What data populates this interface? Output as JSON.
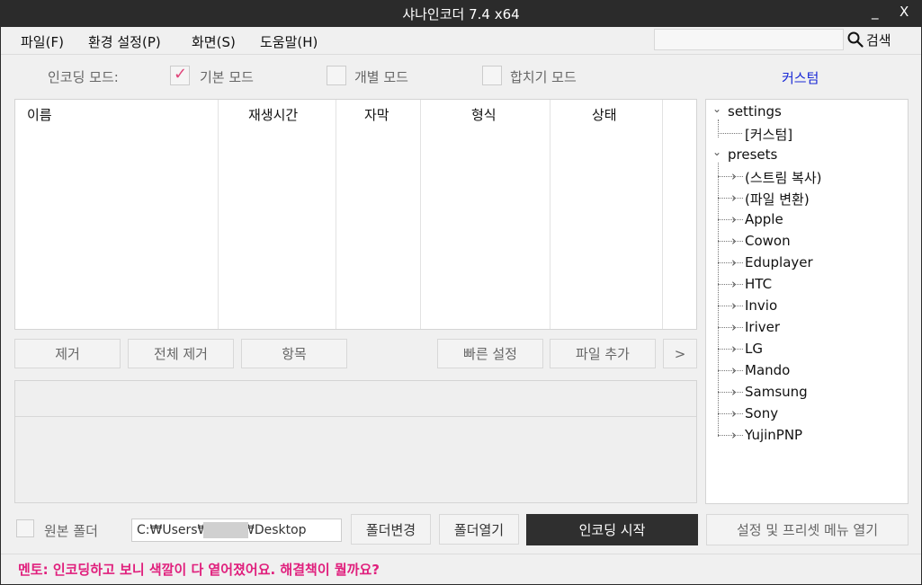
{
  "window": {
    "title": "샤나인코더  7.4 x64",
    "minimize": "_",
    "close": "X"
  },
  "menu": {
    "file": "파일(F)",
    "settings": "환경 설정(P)",
    "view": "화면(S)",
    "help": "도움말(H)"
  },
  "search": {
    "value": "",
    "button_label": "검색",
    "icon": "search-icon"
  },
  "encoding_mode": {
    "label": "인코딩 모드:",
    "options": [
      {
        "label": "기본 모드",
        "checked": true
      },
      {
        "label": "개별 모드",
        "checked": false
      },
      {
        "label": "합치기 모드",
        "checked": false
      }
    ],
    "check_mark": "✓"
  },
  "custom_label": "커스텀",
  "file_table": {
    "columns": [
      "이름",
      "재생시간",
      "자막",
      "형식",
      "상태"
    ],
    "rows": []
  },
  "list_buttons": {
    "remove": "제거",
    "remove_all": "전체 제거",
    "item": "항목",
    "quick_settings": "빠른 설정",
    "add_file": "파일 추가",
    "more": ">"
  },
  "tree": {
    "expander_open": "⌄",
    "expander_closed": "›",
    "settings": {
      "label": "settings",
      "children": [
        "[커스텀]"
      ]
    },
    "presets": {
      "label": "presets",
      "children": [
        "(스트림 복사)",
        "(파일 변환)",
        "Apple",
        "Cowon",
        "Eduplayer",
        "HTC",
        "Invio",
        "Iriver",
        "LG",
        "Mando",
        "Samsung",
        "Sony",
        "YujinPNP"
      ]
    }
  },
  "bottom": {
    "source_folder_label": "원본 폴더",
    "path_value": "C:₩Users₩        ₩Desktop",
    "change_folder": "폴더변경",
    "open_folder": "폴더열기",
    "start_encoding": "인코딩 시작",
    "open_settings_menu": "설정 및 프리셋 메뉴 열기"
  },
  "footer_note": "멘토: 인코딩하고 보니 색깔이 다 옅어졌어요. 해결책이 뭘까요?",
  "colors": {
    "accent_pink": "#e0207d",
    "link_blue": "#1a2ad6",
    "titlebar": "#2b2b2b",
    "start_button": "#2f2f2f"
  }
}
